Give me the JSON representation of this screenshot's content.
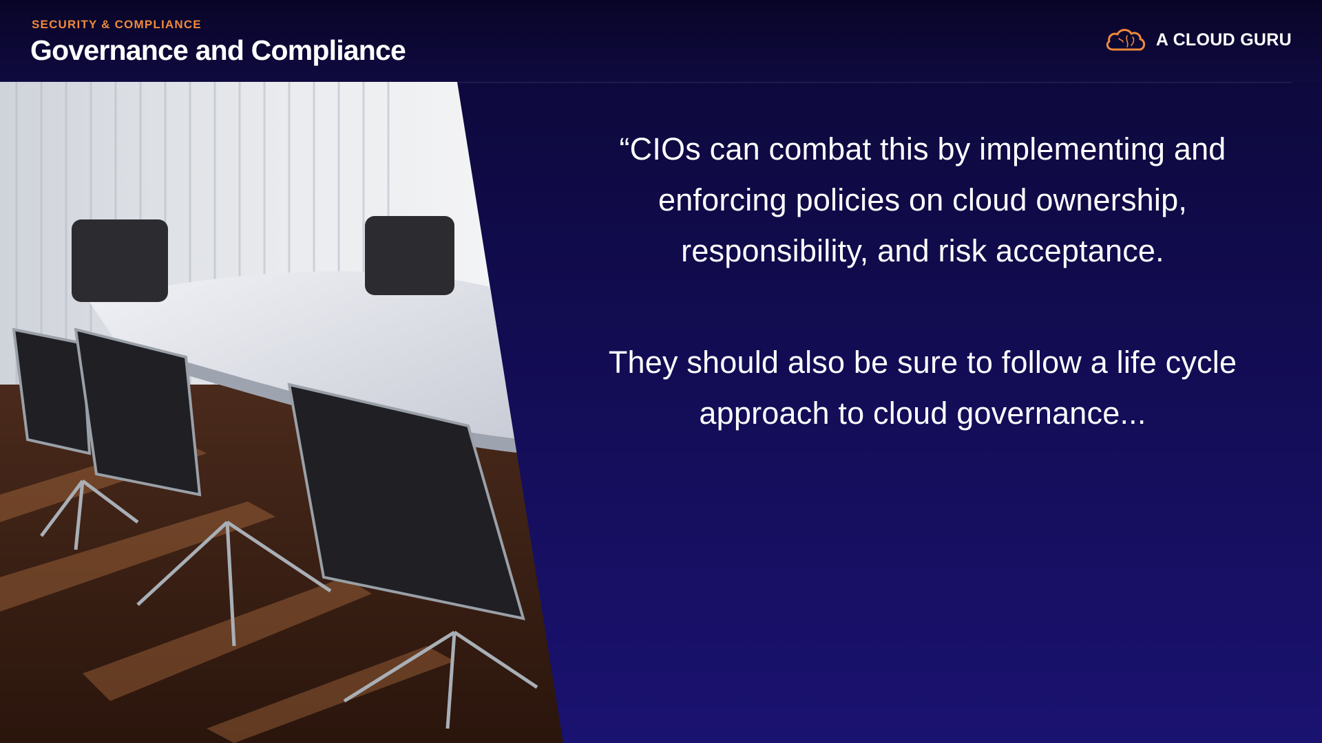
{
  "header": {
    "eyebrow": "SECURITY & COMPLIANCE",
    "title": "Governance and Compliance"
  },
  "brand": {
    "name": "A CLOUD GURU",
    "icon": "cloud-logo-icon",
    "accent_color": "#f08a3c"
  },
  "photo": {
    "subject": "conference-room-image"
  },
  "quote": {
    "paragraph_1": "“CIOs can combat this by implementing and enforcing policies on cloud ownership, responsibility, and risk acceptance.",
    "paragraph_2": "They should also be sure to follow a life cycle approach to cloud governance..."
  },
  "colors": {
    "background": "#120c52",
    "header_background": "#090528",
    "eyebrow": "#f08a3c",
    "text": "#ffffff"
  }
}
